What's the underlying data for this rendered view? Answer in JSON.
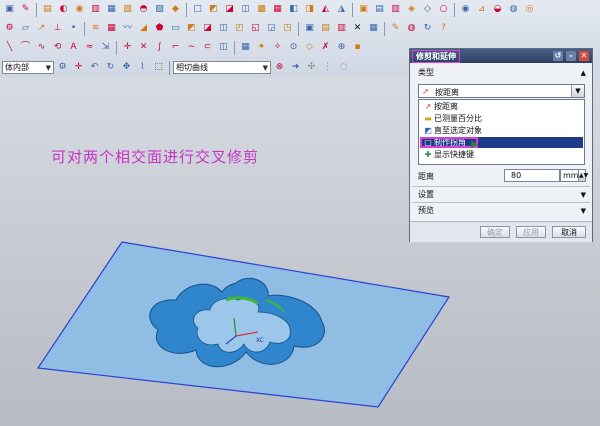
{
  "toolbar": {
    "filter_combo_value": "体内部",
    "curve_rule_combo_value": "相切曲线"
  },
  "annotation": "可对两个相交面进行交叉修剪",
  "dialog": {
    "title": "修剪和延伸",
    "type_section": "类型",
    "type_selected": "按距离",
    "type_options": [
      {
        "label": "按距离",
        "icon": "distance-icon"
      },
      {
        "label": "已测量百分比",
        "icon": "percent-icon"
      },
      {
        "label": "直至选定对象",
        "icon": "until-selected-icon"
      },
      {
        "label": "制作拐角",
        "icon": "make-corner-icon"
      },
      {
        "label": "显示快捷键",
        "icon": "shortcut-icon"
      }
    ],
    "distance_label": "距离",
    "distance_value": "80",
    "distance_unit": "mm",
    "settings_section": "设置",
    "preview_section": "预览",
    "ok_label": "确定",
    "apply_label": "应用",
    "cancel_label": "取消"
  },
  "viewport": {
    "axis_label": "XC"
  },
  "colors": {
    "annotation": "#c633c8",
    "highlight": "#e23cd6",
    "sheet_fill": "#8fbde3",
    "sheet_edge": "#2a3fd6",
    "surface_fill": "#2f86cc",
    "selected_item": "#1f3a8a"
  }
}
